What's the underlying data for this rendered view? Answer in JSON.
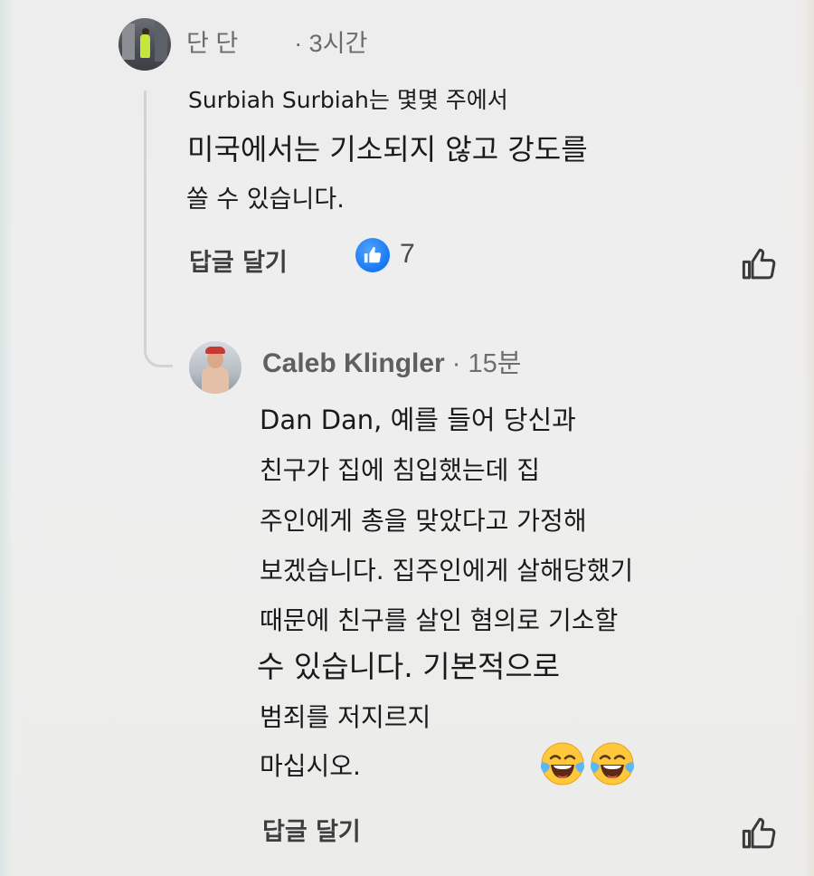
{
  "comment_1": {
    "author": "단 단",
    "time": "· 3시간",
    "reply_context": "Surbiah Surbiah는 몇몇 주에서",
    "lines": [
      "미국에서는 기소되지 않고 강도를",
      "쏠 수 있습니다."
    ],
    "reply_label": "답글 달기",
    "reaction_icon": "thumbs-up-reaction-icon",
    "reaction_count": "7",
    "like_icon": "thumbs-up-outline-icon"
  },
  "comment_2": {
    "author": "Caleb Klingler",
    "time": " · 15분",
    "lines": [
      "Dan Dan, 예를 들어 당신과",
      "친구가 집에 침입했는데 집",
      "주인에게 총을 맞았다고 가정해",
      "보겠습니다. 집주인에게 살해당했기",
      "때문에 친구를 살인 혐의로 기소할",
      "수 있습니다. 기본적으로",
      "범죄를 저지르지",
      "마십시오."
    ],
    "emoji": [
      "laughing-with-tears-emoji",
      "laughing-with-tears-emoji"
    ],
    "reply_label": "답글 달기",
    "like_icon": "thumbs-up-outline-icon"
  },
  "colors": {
    "reaction_blue": "#1877f2",
    "text": "#1a1a1a",
    "muted": "#6b6b6b"
  }
}
